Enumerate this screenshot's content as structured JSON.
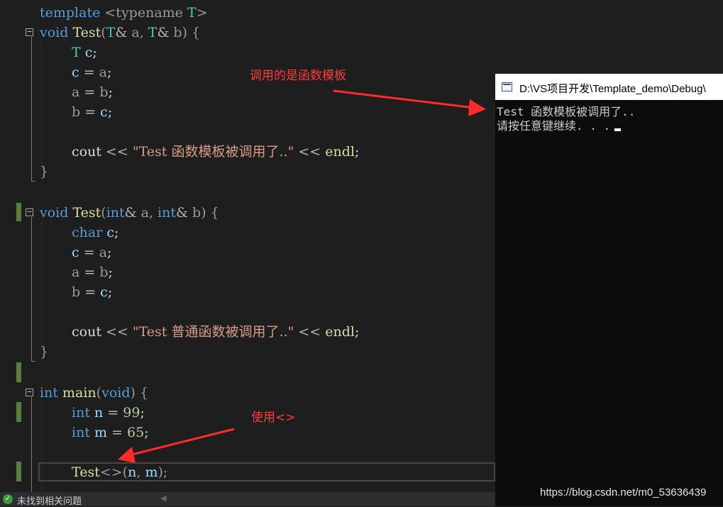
{
  "editor": {
    "lines": {
      "l1": [
        "template ",
        "<typename ",
        "T",
        ">"
      ],
      "l2": [
        "void",
        " ",
        "Test",
        "(",
        "T",
        "& ",
        "a",
        ", ",
        "T",
        "& ",
        "b",
        ") {"
      ],
      "l3": [
        "T",
        " ",
        "c",
        ";"
      ],
      "l4": [
        "c",
        " = ",
        "a",
        ";"
      ],
      "l5": [
        "a",
        " = ",
        "b",
        ";"
      ],
      "l6": [
        "b",
        " = ",
        "c",
        ";"
      ],
      "l8": [
        "cout",
        " << ",
        "\"Test 函数模板被调用了..\"",
        " << ",
        "endl",
        ";"
      ],
      "l9": [
        "}"
      ],
      "l11": [
        "void",
        " ",
        "Test",
        "(",
        "int",
        "& ",
        "a",
        ", ",
        "int",
        "& ",
        "b",
        ") {"
      ],
      "l12": [
        "char",
        " ",
        "c",
        ";"
      ],
      "l13": [
        "c",
        " = ",
        "a",
        ";"
      ],
      "l14": [
        "a",
        " = ",
        "b",
        ";"
      ],
      "l15": [
        "b",
        " = ",
        "c",
        ";"
      ],
      "l17": [
        "cout",
        " << ",
        "\"Test 普通函数被调用了..\"",
        " << ",
        "endl",
        ";"
      ],
      "l18": [
        "}"
      ],
      "l20": [
        "int",
        " ",
        "main",
        "(",
        "void",
        ") {"
      ],
      "l21": [
        "int",
        " ",
        "n",
        " = ",
        "99",
        ";"
      ],
      "l22": [
        "int",
        " ",
        "m",
        " = ",
        "65",
        ";"
      ],
      "l24": [
        "Test",
        "<>",
        "(",
        "n",
        ", ",
        "m",
        ");"
      ]
    }
  },
  "status_bar": {
    "icon": "check-circle-icon",
    "message": "未找到相关问题"
  },
  "console": {
    "title": "D:\\VS项目开发\\Template_demo\\Debug\\",
    "output_line1": "Test 函数模板被调用了..",
    "output_line2": "请按任意键继续. . ."
  },
  "annotations": {
    "top": "调用的是函数模板",
    "bottom": "使用<>",
    "color": "#ff3b3b"
  },
  "watermark": "https://blog.csdn.net/m0_53636439"
}
